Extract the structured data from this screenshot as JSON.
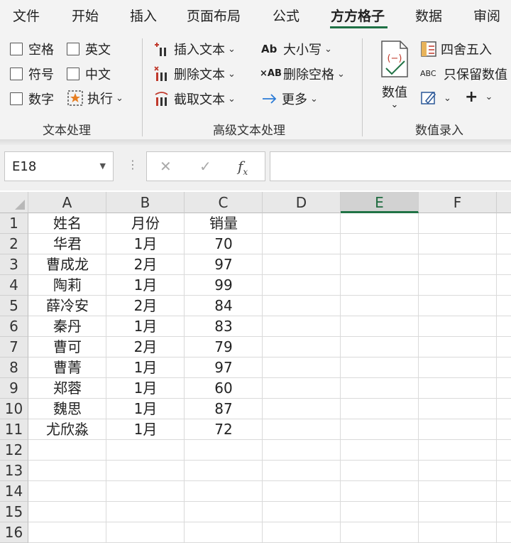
{
  "tabs": [
    {
      "label": "文件"
    },
    {
      "label": "开始"
    },
    {
      "label": "插入"
    },
    {
      "label": "页面布局"
    },
    {
      "label": "公式"
    },
    {
      "label": "方方格子"
    },
    {
      "label": "数据"
    },
    {
      "label": "审阅"
    }
  ],
  "active_tab": "方方格子",
  "ribbon": {
    "text_group": {
      "label": "文本处理",
      "checkboxes": [
        {
          "label": "空格"
        },
        {
          "label": "英文"
        },
        {
          "label": "符号"
        },
        {
          "label": "中文"
        },
        {
          "label": "数字"
        }
      ],
      "execute_label": "执行"
    },
    "advanced_group": {
      "label": "高级文本处理",
      "insert_text": "插入文本",
      "delete_text": "删除文本",
      "extract_text": "截取文本",
      "case_label": "大小写",
      "delete_space": "删除空格",
      "more": "更多"
    },
    "value_group": {
      "label": "数值录入",
      "value_button": "数值",
      "round": "四舍五入",
      "keep_values": "只保留数值",
      "value_icon_text": "(−)",
      "abc_icon_text": "ABC",
      "ab_icon_text": "Ab",
      "xab_icon_text": "×AB",
      "plus_icon_text": "+"
    }
  },
  "formula_bar": {
    "name_box": "E18",
    "formula": ""
  },
  "sheet": {
    "columns": [
      "A",
      "B",
      "C",
      "D",
      "E",
      "F"
    ],
    "selected_column": "E",
    "rows": [
      "1",
      "2",
      "3",
      "4",
      "5",
      "6",
      "7",
      "8",
      "9",
      "10",
      "11",
      "12",
      "13",
      "14",
      "15",
      "16"
    ],
    "header": [
      "姓名",
      "月份",
      "销量"
    ],
    "data": [
      [
        "华君",
        "1月",
        "70"
      ],
      [
        "曹成龙",
        "2月",
        "97"
      ],
      [
        "陶莉",
        "1月",
        "99"
      ],
      [
        "薛冷安",
        "2月",
        "84"
      ],
      [
        "秦丹",
        "1月",
        "83"
      ],
      [
        "曹可",
        "2月",
        "79"
      ],
      [
        "曹菁",
        "1月",
        "97"
      ],
      [
        "郑蓉",
        "1月",
        "60"
      ],
      [
        "魏思",
        "1月",
        "87"
      ],
      [
        "尤欣淼",
        "1月",
        "72"
      ]
    ]
  },
  "colors": {
    "accent": "#217346",
    "ribbon_bg": "#f3f3f3",
    "red_icon": "#c0392b",
    "blue_icon": "#2b7bd6"
  }
}
